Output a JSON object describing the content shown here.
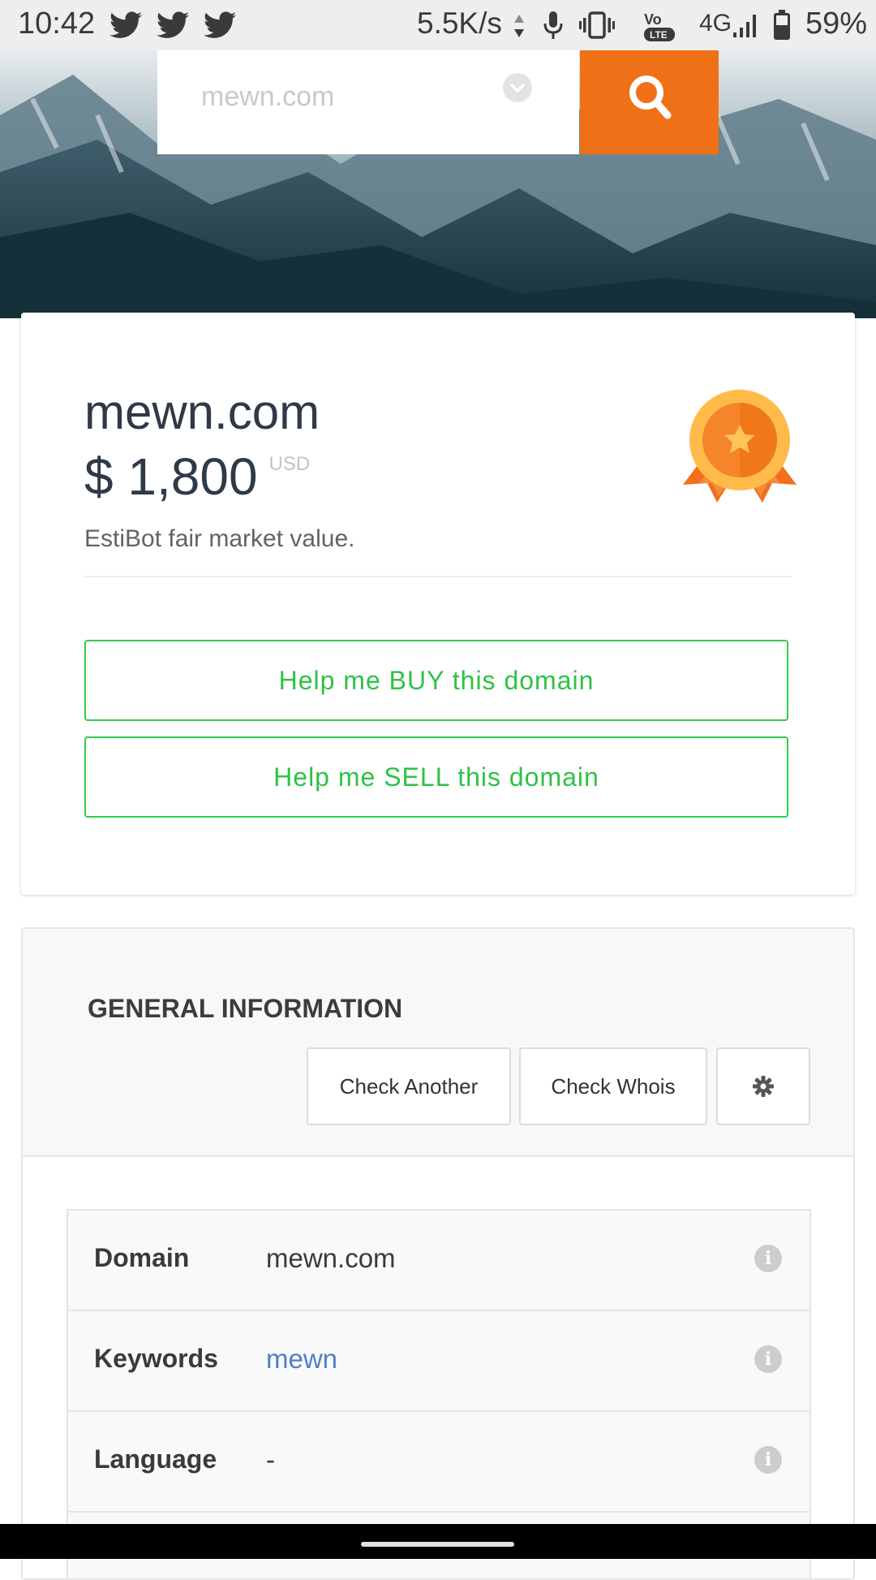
{
  "status_bar": {
    "time": "10:42",
    "network_speed": "5.5K/s",
    "network_type": "4G",
    "battery": "59%",
    "icons": [
      "twitter-icon",
      "twitter-icon",
      "twitter-icon",
      "data-arrows-icon",
      "mic-icon",
      "vibrate-icon",
      "volte-icon",
      "signal-icon",
      "battery-icon"
    ]
  },
  "search": {
    "placeholder": "mewn.com",
    "dropdown_icon": "chevron-down-icon",
    "button_icon": "search-icon",
    "button_color": "#f07017"
  },
  "valuation": {
    "domain": "mewn.com",
    "price": "$ 1,800",
    "currency": "USD",
    "description": "EstiBot fair market value.",
    "badge_icon": "medal-icon",
    "buy_button": "Help me BUY this domain",
    "sell_button": "Help me SELL this domain",
    "accent_color": "#2ecc4c"
  },
  "general_info": {
    "title": "GENERAL INFORMATION",
    "check_another": "Check Another",
    "check_whois": "Check Whois",
    "settings_icon": "gear-icon",
    "rows": [
      {
        "label": "Domain",
        "value": "mewn.com",
        "is_link": false
      },
      {
        "label": "Keywords",
        "value": "mewn",
        "is_link": true
      },
      {
        "label": "Language",
        "value": "-",
        "is_link": false
      }
    ],
    "info_icon": "info-icon"
  }
}
